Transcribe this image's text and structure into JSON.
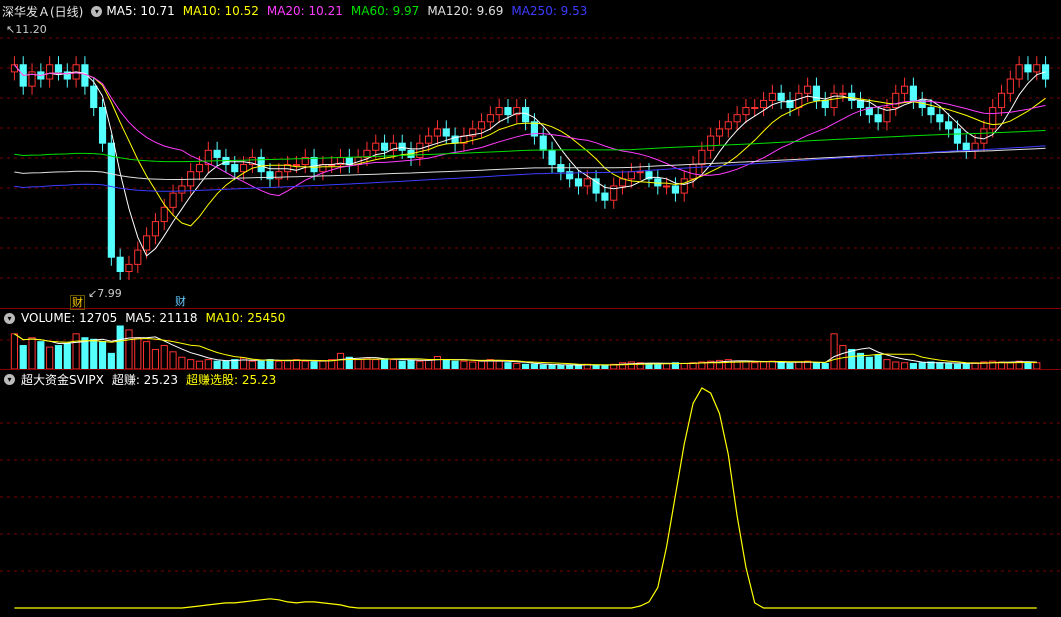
{
  "price_panel": {
    "title": "深华发Ａ(日线)",
    "indicators": [
      {
        "label": "MA5: 10.71",
        "color": "#ffffff"
      },
      {
        "label": "MA10: 10.52",
        "color": "#ffff00"
      },
      {
        "label": "MA20: 10.21",
        "color": "#ff3cff"
      },
      {
        "label": "MA60: 9.97",
        "color": "#00e000"
      },
      {
        "label": "MA120: 9.69",
        "color": "#e0e0e0"
      },
      {
        "label": "MA250: 9.53",
        "color": "#3c3cff"
      }
    ],
    "high_label": "11.20",
    "low_label": "7.99",
    "event_tags": [
      {
        "text": "财",
        "color": "#ffcc00"
      },
      {
        "text": "财",
        "color": "#66ccff"
      }
    ]
  },
  "volume_panel": {
    "title": "VOLUME: 12705",
    "indicators": [
      {
        "label": "MA5: 21118",
        "color": "#ffffff"
      },
      {
        "label": "MA10: 25450",
        "color": "#ffff00"
      }
    ]
  },
  "indicator_panel": {
    "title": "超大资金SVIPX",
    "indicators": [
      {
        "label": "超赚: 25.23",
        "color": "#ffffff"
      },
      {
        "label": "超赚选股: 25.23",
        "color": "#ffff00"
      }
    ]
  },
  "colors": {
    "up": "#ff3232",
    "down": "#54ffff",
    "grid": "#7a0000",
    "indicator_line": "#ffff00"
  },
  "chart_data": [
    {
      "type": "candlestick",
      "description_source": "price panel",
      "series": [
        {
          "name": "MA5",
          "color": "#ffffff"
        },
        {
          "name": "MA10",
          "color": "#ffff00"
        },
        {
          "name": "MA20",
          "color": "#ff3cff"
        },
        {
          "name": "MA60",
          "color": "#00e000"
        },
        {
          "name": "MA120",
          "color": "#e0e0e0"
        },
        {
          "name": "MA250",
          "color": "#3c3cff"
        }
      ],
      "close": [
        10.9,
        10.6,
        10.8,
        10.7,
        10.9,
        10.8,
        10.7,
        10.9,
        10.6,
        10.3,
        9.8,
        8.2,
        8.0,
        8.1,
        8.3,
        8.5,
        8.7,
        8.9,
        9.1,
        9.2,
        9.4,
        9.5,
        9.7,
        9.6,
        9.5,
        9.4,
        9.5,
        9.6,
        9.4,
        9.3,
        9.4,
        9.5,
        9.5,
        9.6,
        9.4,
        9.5,
        9.5,
        9.6,
        9.5,
        9.6,
        9.7,
        9.8,
        9.7,
        9.8,
        9.7,
        9.6,
        9.8,
        9.9,
        10.0,
        9.9,
        9.8,
        9.9,
        10.0,
        10.1,
        10.2,
        10.3,
        10.2,
        10.3,
        10.1,
        9.9,
        9.7,
        9.5,
        9.4,
        9.3,
        9.2,
        9.3,
        9.1,
        9.0,
        9.2,
        9.3,
        9.4,
        9.4,
        9.3,
        9.2,
        9.2,
        9.1,
        9.3,
        9.5,
        9.7,
        9.9,
        10.0,
        10.1,
        10.2,
        10.3,
        10.3,
        10.4,
        10.5,
        10.4,
        10.3,
        10.5,
        10.6,
        10.4,
        10.3,
        10.5,
        10.5,
        10.4,
        10.3,
        10.2,
        10.1,
        10.3,
        10.5,
        10.6,
        10.4,
        10.3,
        10.2,
        10.1,
        10.0,
        9.8,
        9.7,
        9.8,
        10.0,
        10.3,
        10.5,
        10.7,
        10.9,
        10.8,
        10.9,
        10.7
      ],
      "high_label": 11.2,
      "low_label": 7.99
    },
    {
      "type": "bar",
      "description_source": "volume panel",
      "title": "VOLUME",
      "values": [
        45,
        30,
        40,
        35,
        28,
        30,
        32,
        45,
        40,
        38,
        35,
        20,
        55,
        50,
        40,
        35,
        25,
        30,
        22,
        15,
        12,
        10,
        12,
        10,
        10,
        12,
        14,
        10,
        10,
        12,
        10,
        11,
        12,
        10,
        9,
        10,
        12,
        20,
        15,
        12,
        14,
        12,
        13,
        12,
        10,
        11,
        10,
        12,
        16,
        12,
        10,
        10,
        9,
        10,
        12,
        10,
        8,
        7,
        6,
        6,
        5,
        5,
        5,
        5,
        5,
        6,
        5,
        5,
        6,
        8,
        9,
        8,
        7,
        6,
        7,
        8,
        7,
        8,
        9,
        10,
        11,
        12,
        10,
        9,
        8,
        9,
        10,
        8,
        7,
        9,
        10,
        8,
        7,
        45,
        30,
        25,
        20,
        15,
        18,
        12,
        9,
        8,
        7,
        8,
        9,
        8,
        7,
        6,
        7,
        8,
        9,
        10,
        9,
        8,
        10,
        9,
        8
      ],
      "series": [
        {
          "name": "MA5",
          "color": "#ffffff"
        },
        {
          "name": "MA10",
          "color": "#ffff00"
        }
      ]
    },
    {
      "type": "line",
      "description_source": "indicator panel",
      "title": "超大资金SVIPX",
      "series": [
        {
          "name": "超赚",
          "color": "#ffff00"
        }
      ],
      "values": [
        0,
        0,
        0,
        0,
        0,
        0,
        0,
        0,
        0,
        0,
        0,
        0,
        0,
        0,
        0,
        0,
        0,
        0,
        0,
        0,
        1,
        2,
        3,
        4,
        5,
        5,
        6,
        7,
        8,
        9,
        8,
        6,
        5,
        6,
        6,
        5,
        4,
        3,
        1,
        0,
        0,
        0,
        0,
        0,
        0,
        0,
        0,
        0,
        0,
        0,
        0,
        0,
        0,
        0,
        0,
        0,
        0,
        0,
        0,
        0,
        0,
        0,
        0,
        0,
        0,
        0,
        0,
        0,
        0,
        0,
        0,
        2,
        6,
        20,
        60,
        110,
        160,
        200,
        215,
        210,
        190,
        150,
        90,
        40,
        5,
        0,
        0,
        0,
        0,
        0,
        0,
        0,
        0,
        0,
        0,
        0,
        0,
        0,
        0,
        0,
        0,
        0,
        0,
        0,
        0,
        0,
        0,
        0,
        0,
        0,
        0,
        0,
        0,
        0,
        0,
        0,
        0
      ]
    }
  ]
}
